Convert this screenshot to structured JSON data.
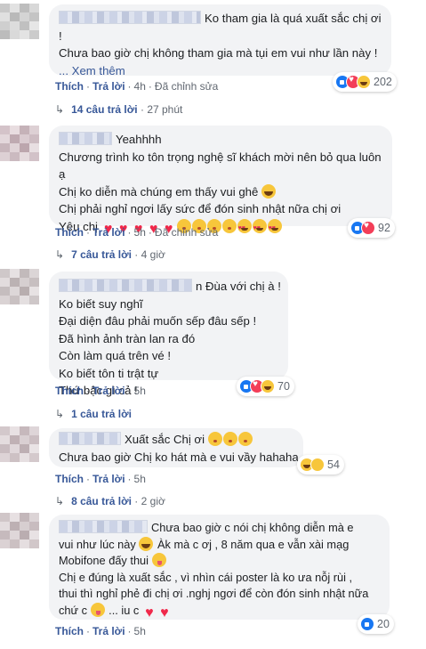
{
  "comments": [
    {
      "lines": [
        "Ko tham gia là quá xuất sắc chị ơi",
        "!",
        "Chưa bao giờ chị không tham gia mà tụi em vui như lần này !"
      ],
      "see_more": "... Xem thêm",
      "reaction_count": "202",
      "actions": {
        "like": "Thích",
        "reply": "Trả lời",
        "time": "4h",
        "edited": "Đã chỉnh sửa"
      },
      "replies": {
        "label": "14 câu trả lời",
        "time": "27 phút"
      }
    },
    {
      "lines": [
        "Yeahhhh",
        "Chương trình ko tôn trọng nghệ sĩ khách mời nên bỏ qua luôn",
        "ạ",
        "Chị ko diễn mà chúng em thấy vui ghê",
        "Chị phải nghỉ ngơi lấy sức để đón sinh nhật nữa chị ơi",
        "Yêu chị"
      ],
      "reaction_count": "92",
      "actions": {
        "like": "Thích",
        "reply": "Trả lời",
        "time": "5h",
        "edited": "Đã chỉnh sửa"
      },
      "replies": {
        "label": "7 câu trả lời",
        "time": "4 giờ"
      }
    },
    {
      "lines": [
        "n Đùa với chị à !",
        "Ko biết suy nghĩ",
        "Đại diện đâu phải muốn sếp đâu sếp !",
        "Đã hình ảnh tràn lan ra đó",
        "Còn làm quá trên vé !",
        "Ko biết tôn ti trật tự",
        "Thứ bậc gì cả !"
      ],
      "reaction_count": "70",
      "actions": {
        "like": "Thích",
        "reply": "Trả lời",
        "time": "5h"
      },
      "replies": {
        "label": "1 câu trả lời"
      }
    },
    {
      "lines": [
        "Xuất sắc Chị ơi",
        "Chưa bao giờ Chị ko hát mà e vui vầy hahaha"
      ],
      "reaction_count": "54",
      "actions": {
        "like": "Thích",
        "reply": "Trả lời",
        "time": "5h"
      },
      "replies": {
        "label": "8 câu trả lời",
        "time": "2 giờ"
      }
    },
    {
      "lines": [
        "Chưa bao giờ c nói chị không diễn mà e",
        "vui như lúc này",
        "Àk mà c ơj , 8 năm qua e vẫn xài mạg",
        "Mobifone đấy thui",
        "Chị e đúng là xuất sắc , vì nhìn cái poster là ko ưa nỗj rùi ,",
        "thui thì nghỉ phẻ đi chị ơi .nghj ngơi để còn đón sinh nhật nữa",
        "chứ c",
        "... iu c"
      ],
      "reaction_count": "20",
      "actions": {
        "like": "Thích",
        "reply": "Trả lời",
        "time": "5h"
      }
    }
  ],
  "icons": {
    "like": "like-reaction-icon",
    "love": "love-reaction-icon",
    "haha": "haha-reaction-icon",
    "reply_arrow": "reply-arrow-icon"
  },
  "colors": {
    "link": "#385898",
    "bubble": "#f2f3f5",
    "meta": "#606770",
    "heart": "#f0284a"
  }
}
